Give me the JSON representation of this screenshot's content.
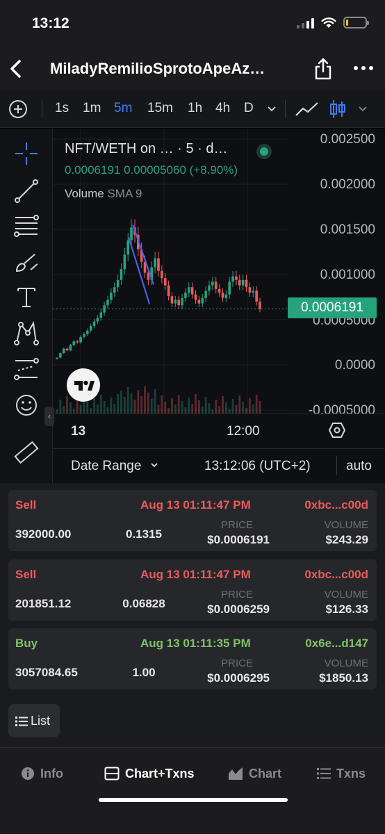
{
  "status": {
    "time": "13:12",
    "battery_level": 0.12
  },
  "header": {
    "title": "MiladyRemilioSprotoApeAz…"
  },
  "toolbar": {
    "timeframes": [
      "1s",
      "1m",
      "5m",
      "15m",
      "1h",
      "4h",
      "D"
    ],
    "active_timeframe": "5m"
  },
  "chart": {
    "legend_pair": "NFT/WETH on … · 5 · d…",
    "legend_values": "0.0006191  0.00005060 (+8.90%)",
    "volume_label": "Volume",
    "volume_sma": "SMA 9",
    "y_ticks": [
      "0.002500",
      "0.002000",
      "0.001500",
      "0.001000",
      "0.0005000",
      "0.0000",
      "-0.0005000"
    ],
    "current_price": "0.0006191",
    "time_labels": [
      "13",
      "12:00"
    ],
    "date_range_label": "Date Range",
    "clock": "13:12:06 (UTC+2)",
    "auto_label": "auto",
    "up_color": "#26a37b",
    "down_color": "#ec5b5b",
    "trendline_color": "#4a5ee8"
  },
  "chart_data": {
    "type": "candlestick",
    "series_name": "NFT/WETH",
    "ylim": [
      -0.0005,
      0.0025
    ],
    "close": [
      8e-05,
      0.00013,
      0.00018,
      0.00016,
      0.00022,
      0.00026,
      0.00025,
      0.00031,
      0.00034,
      0.00038,
      0.00043,
      0.00048,
      0.00052,
      0.00058,
      0.00066,
      0.00072,
      0.0008,
      0.00086,
      0.00094,
      0.00106,
      0.00122,
      0.00138,
      0.00152,
      0.00144,
      0.00128,
      0.00114,
      0.00102,
      0.00094,
      0.00108,
      0.00118,
      0.00104,
      0.00096,
      0.00088,
      0.00076,
      0.00068,
      0.00072,
      0.00066,
      0.00074,
      0.0008,
      0.00086,
      0.00078,
      0.00072,
      0.00068,
      0.00074,
      0.00082,
      0.00088,
      0.00092,
      0.00084,
      0.0008,
      0.00074,
      0.00078,
      0.00092,
      0.00098,
      0.00094,
      0.00088,
      0.00094,
      0.00086,
      0.0008,
      0.00082,
      0.0007,
      0.00062
    ],
    "last_price": 0.0006191,
    "peak_price": 0.00152
  },
  "transactions": [
    {
      "type": "Sell",
      "time": "Aug 13 01:11:47 PM",
      "maker": "0xbc...c00d",
      "amount": "392000.00",
      "eth": "0.1315",
      "price_label": "PRICE",
      "price": "$0.0006191",
      "volume_label": "VOLUME",
      "volume": "$243.29"
    },
    {
      "type": "Sell",
      "time": "Aug 13 01:11:47 PM",
      "maker": "0xbc...c00d",
      "amount": "201851.12",
      "eth": "0.06828",
      "price_label": "PRICE",
      "price": "$0.0006259",
      "volume_label": "VOLUME",
      "volume": "$126.33"
    },
    {
      "type": "Buy",
      "time": "Aug 13 01:11:35 PM",
      "maker": "0x6e...d147",
      "amount": "3057084.65",
      "eth": "1.00",
      "price_label": "PRICE",
      "price": "$0.0006295",
      "volume_label": "VOLUME",
      "volume": "$1850.13"
    }
  ],
  "list_button": "List",
  "bottom_nav": [
    {
      "label": "Info",
      "icon": "info-icon"
    },
    {
      "label": "Chart+Txns",
      "icon": "split-view-icon",
      "active": true
    },
    {
      "label": "Chart",
      "icon": "area-chart-icon"
    },
    {
      "label": "Txns",
      "icon": "list-icon"
    }
  ]
}
